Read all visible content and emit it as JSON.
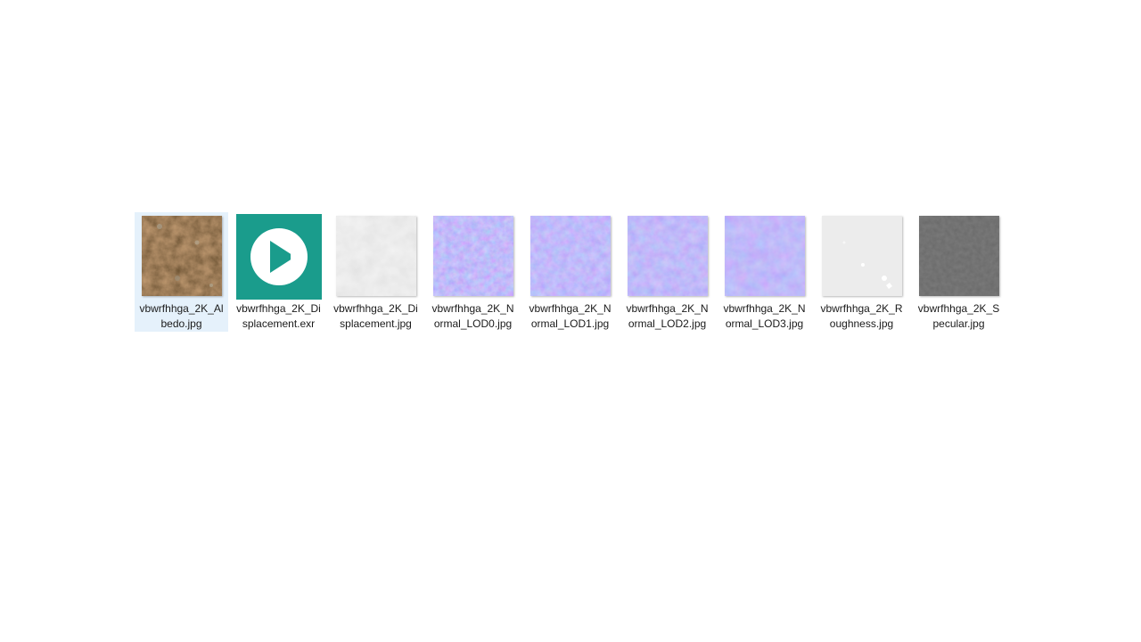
{
  "files": [
    {
      "name": "vbwrfhhga_2K_Albedo.jpg",
      "icon": "albedo-thumbnail-icon",
      "selected": true
    },
    {
      "name": "vbwrfhhga_2K_Displacement.exr",
      "icon": "media-player-icon",
      "selected": false
    },
    {
      "name": "vbwrfhhga_2K_Displacement.jpg",
      "icon": "displacement-thumbnail-icon",
      "selected": false
    },
    {
      "name": "vbwrfhhga_2K_Normal_LOD0.jpg",
      "icon": "normal-map-thumbnail-icon",
      "selected": false
    },
    {
      "name": "vbwrfhhga_2K_Normal_LOD1.jpg",
      "icon": "normal-map-thumbnail-icon",
      "selected": false
    },
    {
      "name": "vbwrfhhga_2K_Normal_LOD2.jpg",
      "icon": "normal-map-thumbnail-icon",
      "selected": false
    },
    {
      "name": "vbwrfhhga_2K_Normal_LOD3.jpg",
      "icon": "normal-map-thumbnail-icon",
      "selected": false
    },
    {
      "name": "vbwrfhhga_2K_Roughness.jpg",
      "icon": "roughness-thumbnail-icon",
      "selected": false
    },
    {
      "name": "vbwrfhhga_2K_Specular.jpg",
      "icon": "specular-thumbnail-icon",
      "selected": false
    }
  ],
  "colors": {
    "selection": "#e5f1fb",
    "media_tile": "#1a9c8c",
    "albedo": "#5a3b22",
    "displacement": "#d6d6d6",
    "normal": "#7a6ff0",
    "roughness": "#ececec",
    "specular": "#2a2a2a"
  }
}
